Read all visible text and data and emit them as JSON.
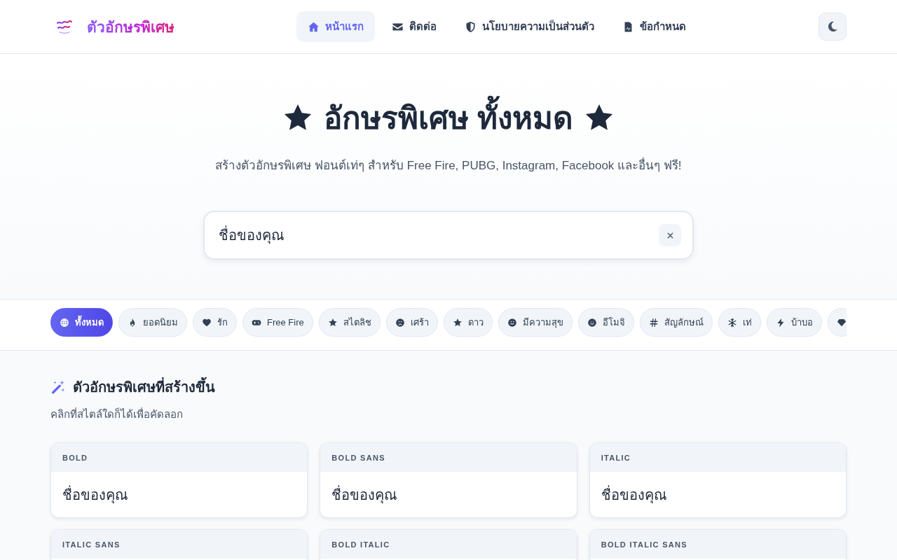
{
  "header": {
    "brand": "ตัวอักษรพิเศษ",
    "nav": [
      {
        "label": "หน้าแรก",
        "selected": true
      },
      {
        "label": "ติดต่อ",
        "selected": false
      },
      {
        "label": "นโยบายความเป็นส่วนตัว",
        "selected": false
      },
      {
        "label": "ข้อกำหนด",
        "selected": false
      }
    ]
  },
  "hero": {
    "title": "อักษรพิเศษ ทั้งหมด",
    "subtitle": "สร้างตัวอักษรพิเศษ ฟอนต์เท่ๆ สำหรับ Free Fire, PUBG, Instagram, Facebook และอื่นๆ ฟรี!",
    "input": {
      "value": "ชื่อของคุณ"
    }
  },
  "categories": [
    {
      "label": "ทั้งหมด",
      "selected": true
    },
    {
      "label": "ยอดนิยม",
      "selected": false
    },
    {
      "label": "รัก",
      "selected": false
    },
    {
      "label": "Free Fire",
      "selected": false
    },
    {
      "label": "สไตลิช",
      "selected": false
    },
    {
      "label": "เศร้า",
      "selected": false
    },
    {
      "label": "ดาว",
      "selected": false
    },
    {
      "label": "มีความสุข",
      "selected": false
    },
    {
      "label": "อีโมจิ",
      "selected": false
    },
    {
      "label": "สัญลักษณ์",
      "selected": false
    },
    {
      "label": "เท่",
      "selected": false
    },
    {
      "label": "บ้าบอ",
      "selected": false
    },
    {
      "selected": false
    }
  ],
  "results": {
    "title": "ตัวอักษรพิเศษที่สร้างขึ้น",
    "subtitle": "คลิกที่สไตล์ใดก็ได้เพื่อคัดลอก",
    "cards": [
      {
        "style": "BOLD",
        "value": "ชื่อของคุณ"
      },
      {
        "style": "BOLD SANS",
        "value": "ชื่อของคุณ"
      },
      {
        "style": "ITALIC",
        "value": "ชื่อของคุณ"
      },
      {
        "style": "ITALIC SANS"
      },
      {
        "style": "BOLD ITALIC"
      },
      {
        "style": "BOLD ITALIC SANS"
      }
    ]
  }
}
